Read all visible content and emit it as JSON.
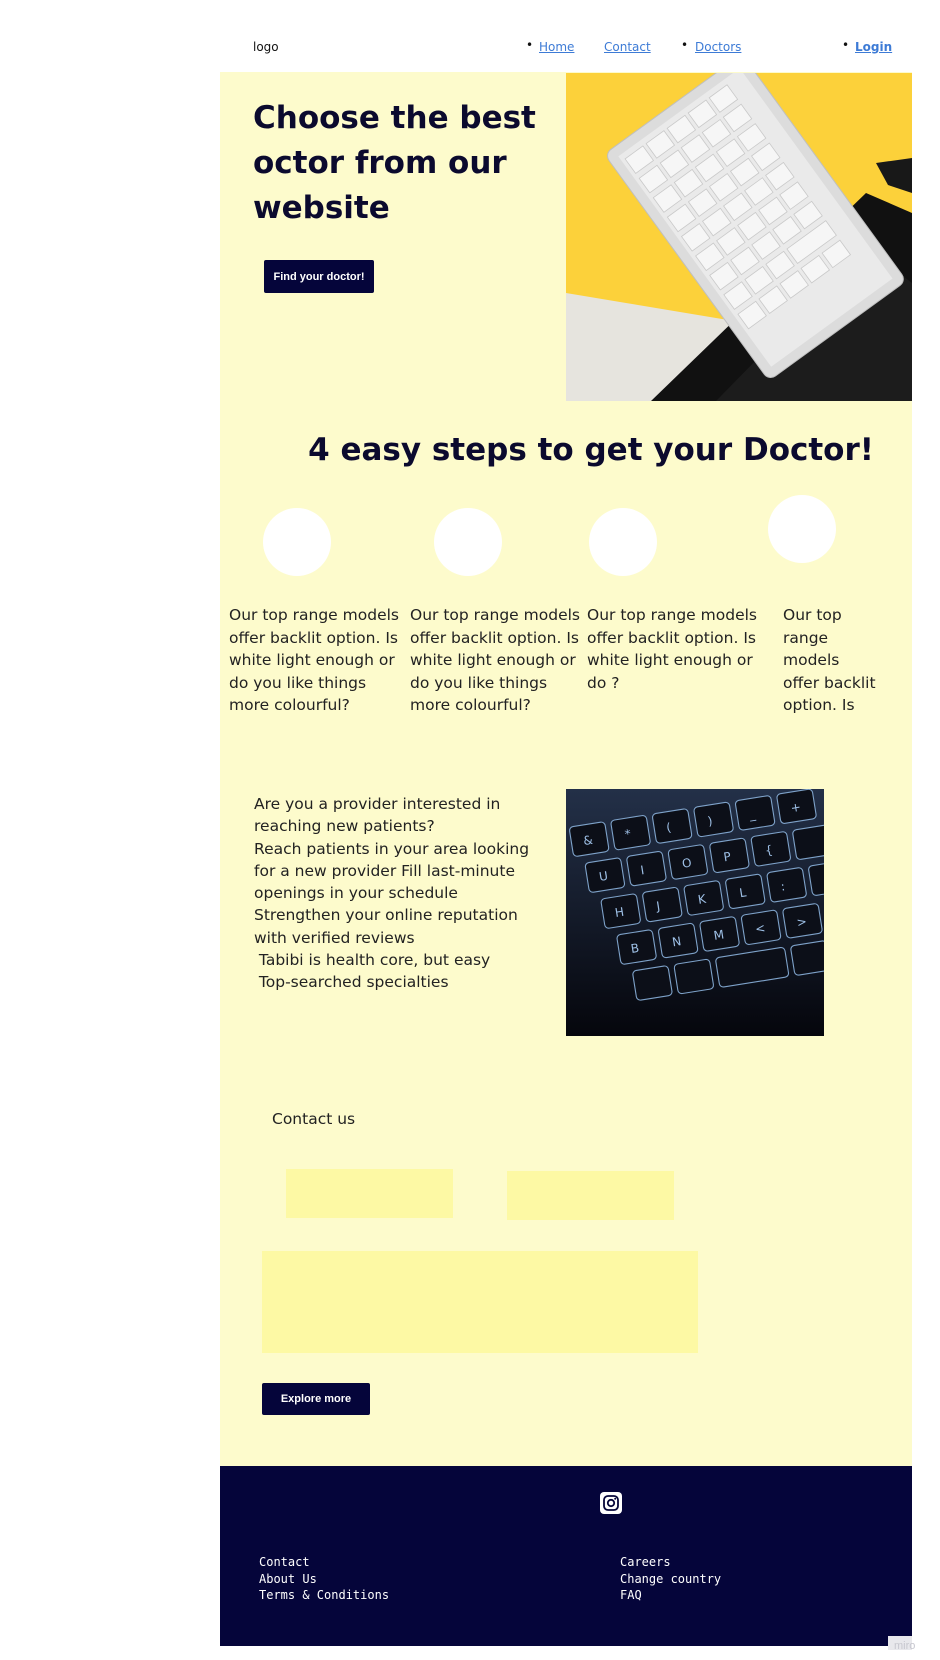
{
  "header": {
    "logo": "logo",
    "nav": [
      {
        "label": "Home"
      },
      {
        "label": "Contact"
      },
      {
        "label": "Doctors"
      },
      {
        "label": "Login"
      }
    ]
  },
  "hero": {
    "title": "Choose the best octor from our website",
    "button": "Find your doctor!"
  },
  "steps": {
    "title": "4 easy steps to get your Doctor!",
    "items": [
      {
        "text": "Our top range models offer backlit option. Is white light enough or do you like things more colourful?"
      },
      {
        "text": "Our top range models offer backlit option. Is white light enough or do you like things more colourful?"
      },
      {
        "text": "Our top range models offer backlit option. Is white light enough or do ?"
      },
      {
        "text": "Our top range models offer backlit option. Is"
      }
    ]
  },
  "provider": {
    "line1": "Are you a provider interested in reaching new patients?",
    "line2": "Reach patients in your area looking for a new provider Fill last-minute openings in your schedule Strengthen your online reputation with verified reviews",
    "line3": " Tabibi is health core, but easy",
    "line4": " Top-searched specialties"
  },
  "contact": {
    "title": "Contact us",
    "button": "Explore more"
  },
  "footer": {
    "left": [
      "Contact",
      "About Us",
      "Terms & Conditions"
    ],
    "right": [
      "Careers",
      "Change country",
      "FAQ"
    ]
  },
  "watermark": "miro",
  "colors": {
    "navy": "#05053a",
    "cream": "#fdfbcc",
    "field": "#fdf9a4",
    "link": "#3d7bd6",
    "hero_yellow": "#fcd13a"
  }
}
